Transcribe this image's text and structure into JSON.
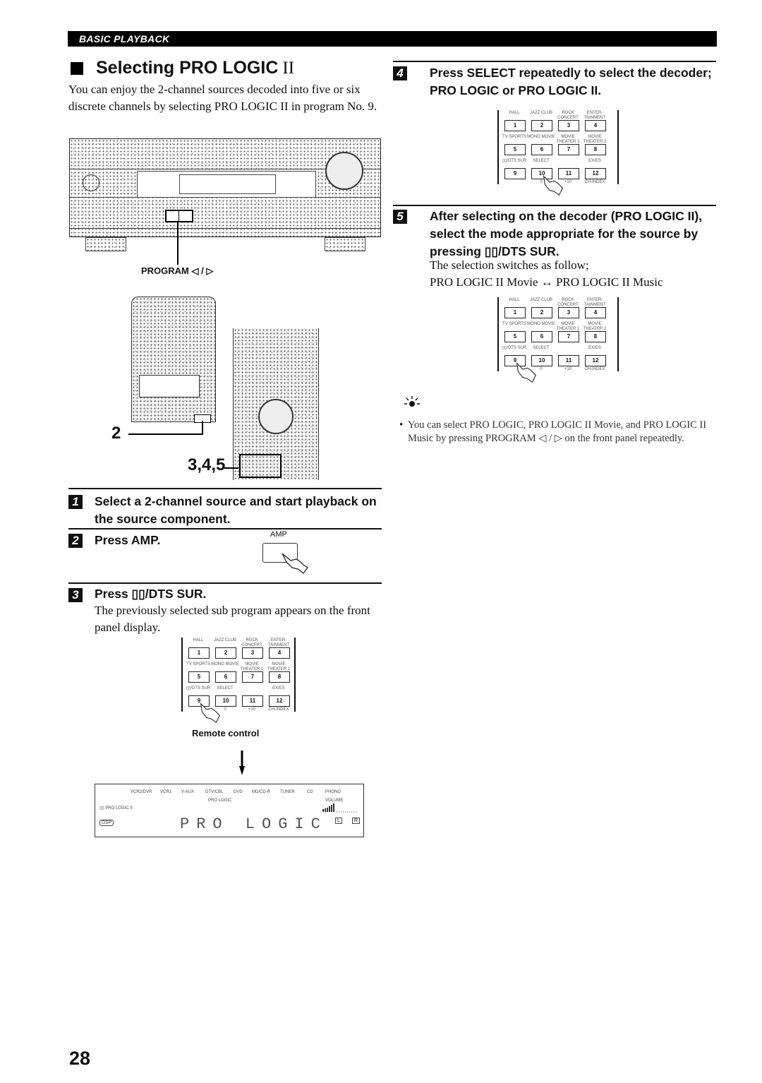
{
  "header": {
    "section": "BASIC PLAYBACK"
  },
  "title": {
    "text": "Selecting PRO LOGIC",
    "roman": "II"
  },
  "intro": "You can enjoy the 2-channel sources decoded into five or six discrete channels by selecting PRO LOGIC II in program No. 9.",
  "figures": {
    "front_panel_callout": "PROGRAM ◁ / ▷",
    "remote_callout_2": "2",
    "remote_callout_345": "3,4,5",
    "amp_label": "AMP",
    "remote_caption": "Remote control"
  },
  "steps": [
    {
      "num": "1",
      "title": "Select a 2-channel source and start playback on the source component.",
      "body": ""
    },
    {
      "num": "2",
      "title": "Press AMP.",
      "body": ""
    },
    {
      "num": "3",
      "title": "Press ▯▯/DTS SUR.",
      "body": "The previously selected sub program appears on the front panel display."
    },
    {
      "num": "4",
      "title": "Press SELECT repeatedly to select the decoder; PRO LOGIC or PRO LOGIC II.",
      "body": ""
    },
    {
      "num": "5",
      "title": "After selecting on the decoder (PRO LOGIC II), select the mode appropriate for the source by pressing ▯▯/DTS SUR.",
      "body": "The selection switches as follow;",
      "body2": "PRO LOGIC II Movie ↔ PRO LOGIC II Music"
    }
  ],
  "keypad": {
    "keys": [
      "1",
      "2",
      "3",
      "4",
      "5",
      "6",
      "7",
      "8",
      "9",
      "10",
      "11",
      "12"
    ],
    "labels": [
      "HALL",
      "JAZZ CLUB",
      "ROCK CONCERT",
      "ENTER-TAINMENT",
      "TV SPORTS",
      "MONO MOVIE",
      "MOVIE THEATER 1",
      "MOVIE THEATER 2",
      "▯▯/DTS SUR",
      "SELECT",
      "",
      "EX/ES"
    ],
    "sublabels": [
      "",
      "0",
      "+10",
      "CH-INDEX"
    ]
  },
  "display": {
    "sources": [
      "VCR2/DVR",
      "VCR1",
      "V-AUX",
      "DTV/CBL",
      "DVD",
      "MD/CD-R",
      "TUNER",
      "CD",
      "PHONO"
    ],
    "mode_indicator": "PRO LOGIC",
    "left_indicator": "▯▯ PRO LOGIC II",
    "dsp": "DSP",
    "volume_label": "VOLUME",
    "main_text": "PRO LOGIC",
    "ch_left": "L",
    "ch_right": "R"
  },
  "tip": {
    "icon": "lightbulb-icon",
    "text": "You can select PRO LOGIC, PRO LOGIC II Movie, and PRO LOGIC II Music by pressing PROGRAM ◁ / ▷ on the front panel repeatedly."
  },
  "page_number": "28"
}
